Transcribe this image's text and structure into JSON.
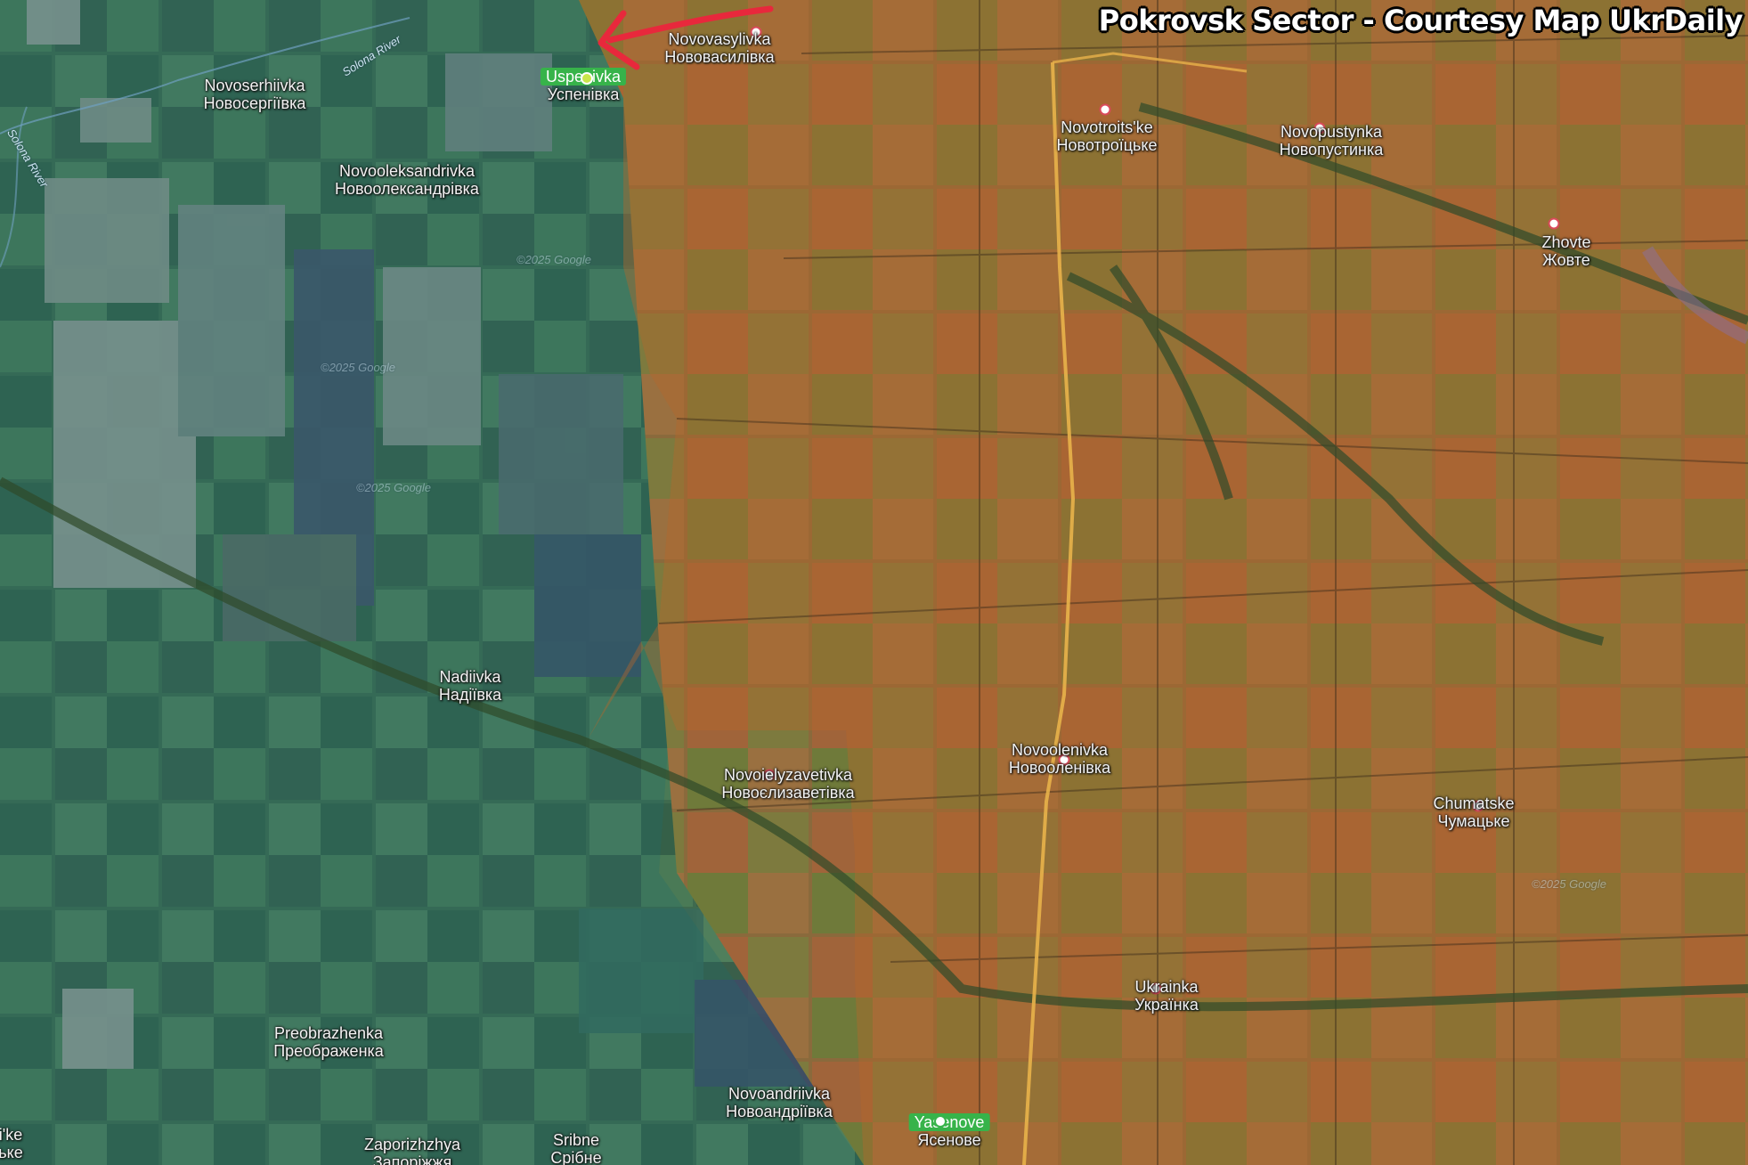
{
  "title": "Pokrovsk Sector - Courtesy Map UkrDaily",
  "colors": {
    "occupied_overlay": "#b5662a",
    "controlled_overlay": "#1e6b6a",
    "arrow": "#e8283c",
    "road": "#e8b24a",
    "place_dot_border": "#d94a5a"
  },
  "places": [
    {
      "id": "novoserhiivka",
      "latin": "Novoserhiivka",
      "cyrillic": "Новосергіївка"
    },
    {
      "id": "uspenivka",
      "latin": "Uspenivka",
      "cyrillic": "Успенівка"
    },
    {
      "id": "novovasylivka",
      "latin": "Novovasylivka",
      "cyrillic": "Нововасилівка"
    },
    {
      "id": "novooleksandrivka",
      "latin": "Novooleksandrivka",
      "cyrillic": "Новоолександрівка"
    },
    {
      "id": "novotroitske",
      "latin": "Novotroits'ke",
      "cyrillic": "Новотроїцьке"
    },
    {
      "id": "novopustynka",
      "latin": "Novopustynka",
      "cyrillic": "Новопустинка"
    },
    {
      "id": "zhovte",
      "latin": "Zhovte",
      "cyrillic": "Жовте"
    },
    {
      "id": "nadiivka",
      "latin": "Nadiivka",
      "cyrillic": "Надіївка"
    },
    {
      "id": "novoielyzavetivka",
      "latin": "Novoielyzavetivka",
      "cyrillic": "Новоєлизаветівка"
    },
    {
      "id": "novoolenivka",
      "latin": "Novoolenivka",
      "cyrillic": "Новооленівка"
    },
    {
      "id": "chumatske",
      "latin": "Chumatske",
      "cyrillic": "Чумацьке"
    },
    {
      "id": "ukrainka",
      "latin": "Ukrainka",
      "cyrillic": "Українка"
    },
    {
      "id": "preobrazhenka",
      "latin": "Preobrazhenka",
      "cyrillic": "Преображенка"
    },
    {
      "id": "novoandriivka",
      "latin": "Novoandriivka",
      "cyrillic": "Новоандріївка"
    },
    {
      "id": "yasenove",
      "latin": "Yasenove",
      "cyrillic": "Ясенове"
    },
    {
      "id": "zaporizhzhya",
      "latin": "Zaporizhzhya",
      "cyrillic": "Запоріжжя"
    },
    {
      "id": "sribne",
      "latin": "Sribne",
      "cyrillic": "Срібне"
    },
    {
      "id": "edge_left",
      "latin": "i'ke",
      "cyrillic": "ьке"
    }
  ],
  "rivers": [
    {
      "id": "solona_river_1",
      "label": "Solona River"
    },
    {
      "id": "solona_river_2",
      "label": "Solona River"
    }
  ],
  "watermarks": [
    "©2025 Google",
    "©2025 Google",
    "©2025 Google",
    "©2025 Google"
  ]
}
